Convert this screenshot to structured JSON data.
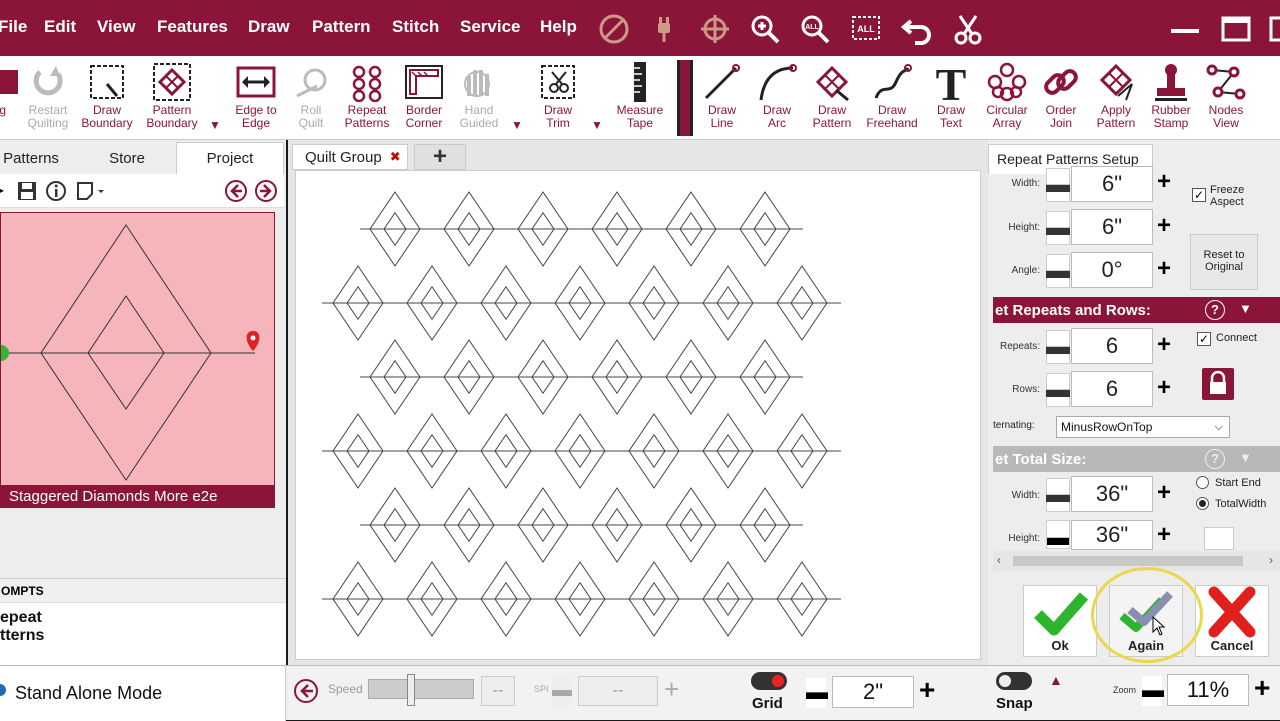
{
  "menu": {
    "items": [
      "File",
      "Edit",
      "View",
      "Features",
      "Draw",
      "Pattern",
      "Stitch",
      "Service",
      "Help"
    ]
  },
  "toolbar": {
    "tools": [
      {
        "label": "ing",
        "icon": "partial-tool-icon",
        "disabled": false
      },
      {
        "label": "Restart\nQuilting",
        "icon": "restart-quilting-icon",
        "disabled": true
      },
      {
        "label": "Draw\nBoundary",
        "icon": "draw-boundary-icon",
        "disabled": false
      },
      {
        "label": "Pattern\nBoundary",
        "icon": "pattern-boundary-icon",
        "disabled": false
      },
      {
        "label": "Edge to\nEdge",
        "icon": "edge-to-edge-icon",
        "disabled": false
      },
      {
        "label": "Roll\nQuilt",
        "icon": "roll-quilt-icon",
        "disabled": true
      },
      {
        "label": "Repeat\nPatterns",
        "icon": "repeat-patterns-icon",
        "disabled": false
      },
      {
        "label": "Border\nCorner",
        "icon": "border-corner-icon",
        "disabled": false
      },
      {
        "label": "Hand\nGuided",
        "icon": "hand-guided-icon",
        "disabled": true
      },
      {
        "label": "Draw\nTrim",
        "icon": "draw-trim-icon",
        "disabled": false
      },
      {
        "label": "Measure\nTape",
        "icon": "measure-tape-icon",
        "disabled": false
      },
      {
        "label": "Draw\nLine",
        "icon": "draw-line-icon",
        "disabled": false
      },
      {
        "label": "Draw\nArc",
        "icon": "draw-arc-icon",
        "disabled": false
      },
      {
        "label": "Draw\nPattern",
        "icon": "draw-pattern-icon",
        "disabled": false
      },
      {
        "label": "Draw\nFreehand",
        "icon": "draw-freehand-icon",
        "disabled": false
      },
      {
        "label": "Draw\nText",
        "icon": "draw-text-icon",
        "disabled": false
      },
      {
        "label": "Circular\nArray",
        "icon": "circular-array-icon",
        "disabled": false
      },
      {
        "label": "Order\nJoin",
        "icon": "order-join-icon",
        "disabled": false
      },
      {
        "label": "Apply\nPattern",
        "icon": "apply-pattern-icon",
        "disabled": false
      },
      {
        "label": "Rubber\nStamp",
        "icon": "rubber-stamp-icon",
        "disabled": false
      },
      {
        "label": "Nodes\nView",
        "icon": "nodes-view-icon",
        "disabled": false
      }
    ]
  },
  "left": {
    "tabs": [
      "Patterns",
      "Store",
      "Project"
    ],
    "pattern_name": "Staggered Diamonds More e2e",
    "prompts_header": "OMPTS",
    "prompt_text_1": "epeat",
    "prompt_text_2": "tterns",
    "mode": "Stand Alone Mode"
  },
  "canvas": {
    "tab_label": "Quilt Group",
    "close_glyph": "✖",
    "add_glyph": "+"
  },
  "right": {
    "title": "Repeat Patterns Setup",
    "width_label": "Width:",
    "width_value": "6\"",
    "height_label": "Height:",
    "height_value": "6\"",
    "angle_label": "Angle:",
    "angle_value": "0°",
    "freeze_aspect": "Freeze Aspect",
    "reset_label": "Reset to Original",
    "repeats_section": "et Repeats and Rows:",
    "repeats_label": "Repeats:",
    "repeats_value": "6",
    "rows_label": "Rows:",
    "rows_value": "6",
    "connect_label": "Connect",
    "alternating_label": "ternating:",
    "alternating_value": "MinusRowOnTop",
    "total_section": "et Total Size:",
    "total_width_label": "Width:",
    "total_width_value": "36\"",
    "total_height_label": "Height:",
    "total_height_value": "36\"",
    "start_end": "Start End",
    "total_width_opt": "TotalWidth",
    "ok_label": "Ok",
    "again_label": "Again",
    "cancel_label": "Cancel"
  },
  "status": {
    "speed_label": "Speed",
    "speed_value": "--",
    "spi_label": "SPI",
    "spi_value": "--",
    "grid_label": "Grid",
    "grid_value": "2\"",
    "snap_label": "Snap",
    "zoom_label": "Zoom",
    "zoom_value": "11%"
  },
  "colors": {
    "brand": "#8b1538",
    "pattern_preview_bg": "#f6b4bb",
    "ok_green": "#2db52d",
    "cancel_red": "#e0201c",
    "highlight_ring": "#e8d84a"
  }
}
